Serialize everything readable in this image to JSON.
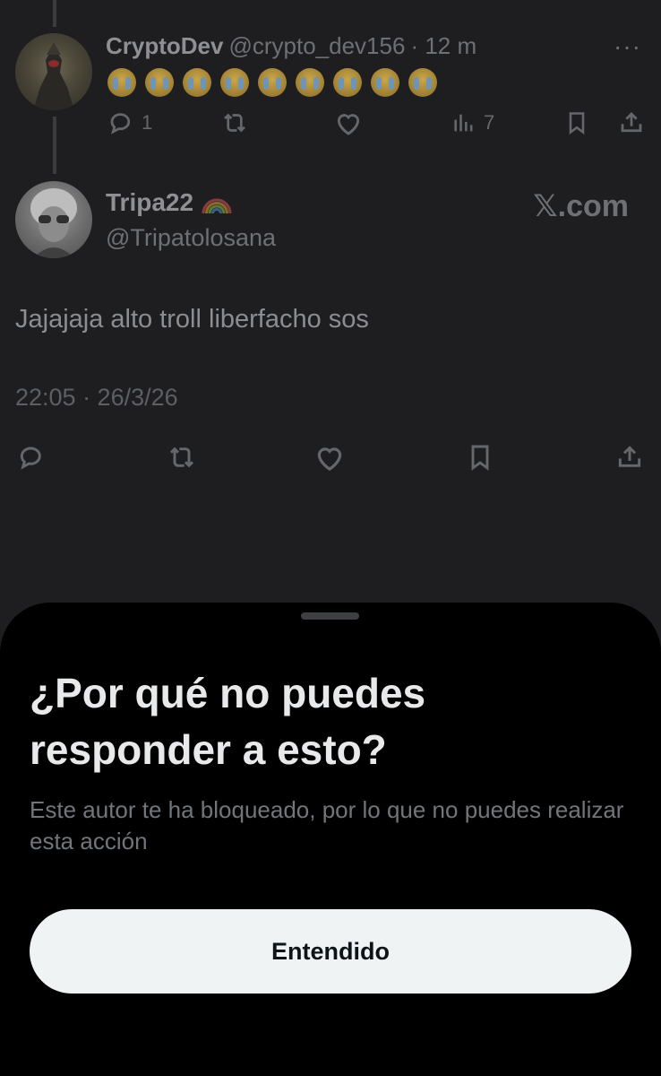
{
  "parent_tweet": {
    "display_name": "CryptoDev",
    "handle": "@crypto_dev156",
    "time": "· 12 m",
    "emoji_count": 9,
    "emoji_name": "loudly-crying-face",
    "reply_count": "1",
    "views_count": "7",
    "more_icon": "more-horizontal-icon"
  },
  "main_tweet": {
    "display_name": "Tripa22",
    "handle": "@Tripatolosana",
    "watermark": "𝕏.com",
    "text": "Jajajaja alto troll liberfacho sos",
    "timestamp": "22:05 · 26/3/26"
  },
  "sheet": {
    "title": "¿Por qué no puedes responder a esto?",
    "body": "Este autor te ha bloqueado, por lo que no puedes realizar esta acción",
    "button_label": "Entendido"
  },
  "colors": {
    "background": "#1e1e21",
    "sheet_background": "#000000",
    "button_background": "#eff3f4",
    "title_text": "#e7e9ea",
    "secondary_text": "#71767b"
  }
}
